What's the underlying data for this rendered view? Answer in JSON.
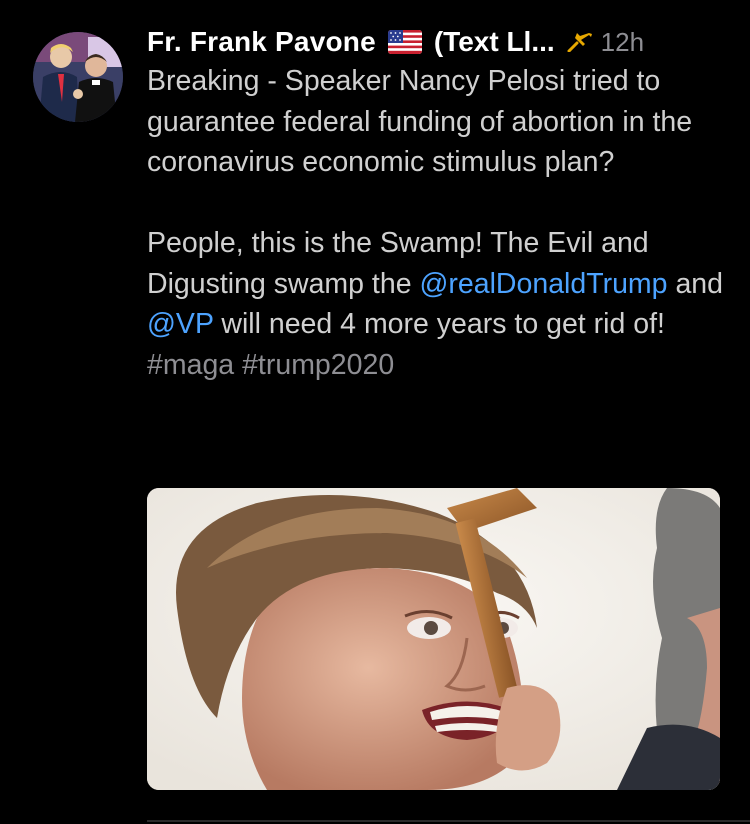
{
  "tweet": {
    "display_name": "Fr. Frank Pavone",
    "display_name_suffix": "(Text Ll...",
    "timestamp": "12h",
    "paragraph1": "Breaking - Speaker Nancy Pelosi tried to guarantee federal funding of abortion in the coronavirus economic stimulus plan?",
    "paragraph2_part1": "People, this is the Swamp! The Evil and Digusting swamp the",
    "mention1": "@realDonaldTrump",
    "paragraph2_and": "and",
    "mention2": "@VP",
    "paragraph2_part2": "will need 4 more years to get rid of!",
    "hashtag1": "#maga",
    "hashtag2": "#trump2020",
    "icons": {
      "flag": "us-flag-icon",
      "pin": "pin-icon"
    }
  },
  "colors": {
    "background": "#000000",
    "name": "#ffffff",
    "text": "#d0d0d0",
    "link": "#4da3ff",
    "muted": "#8e8e93"
  }
}
